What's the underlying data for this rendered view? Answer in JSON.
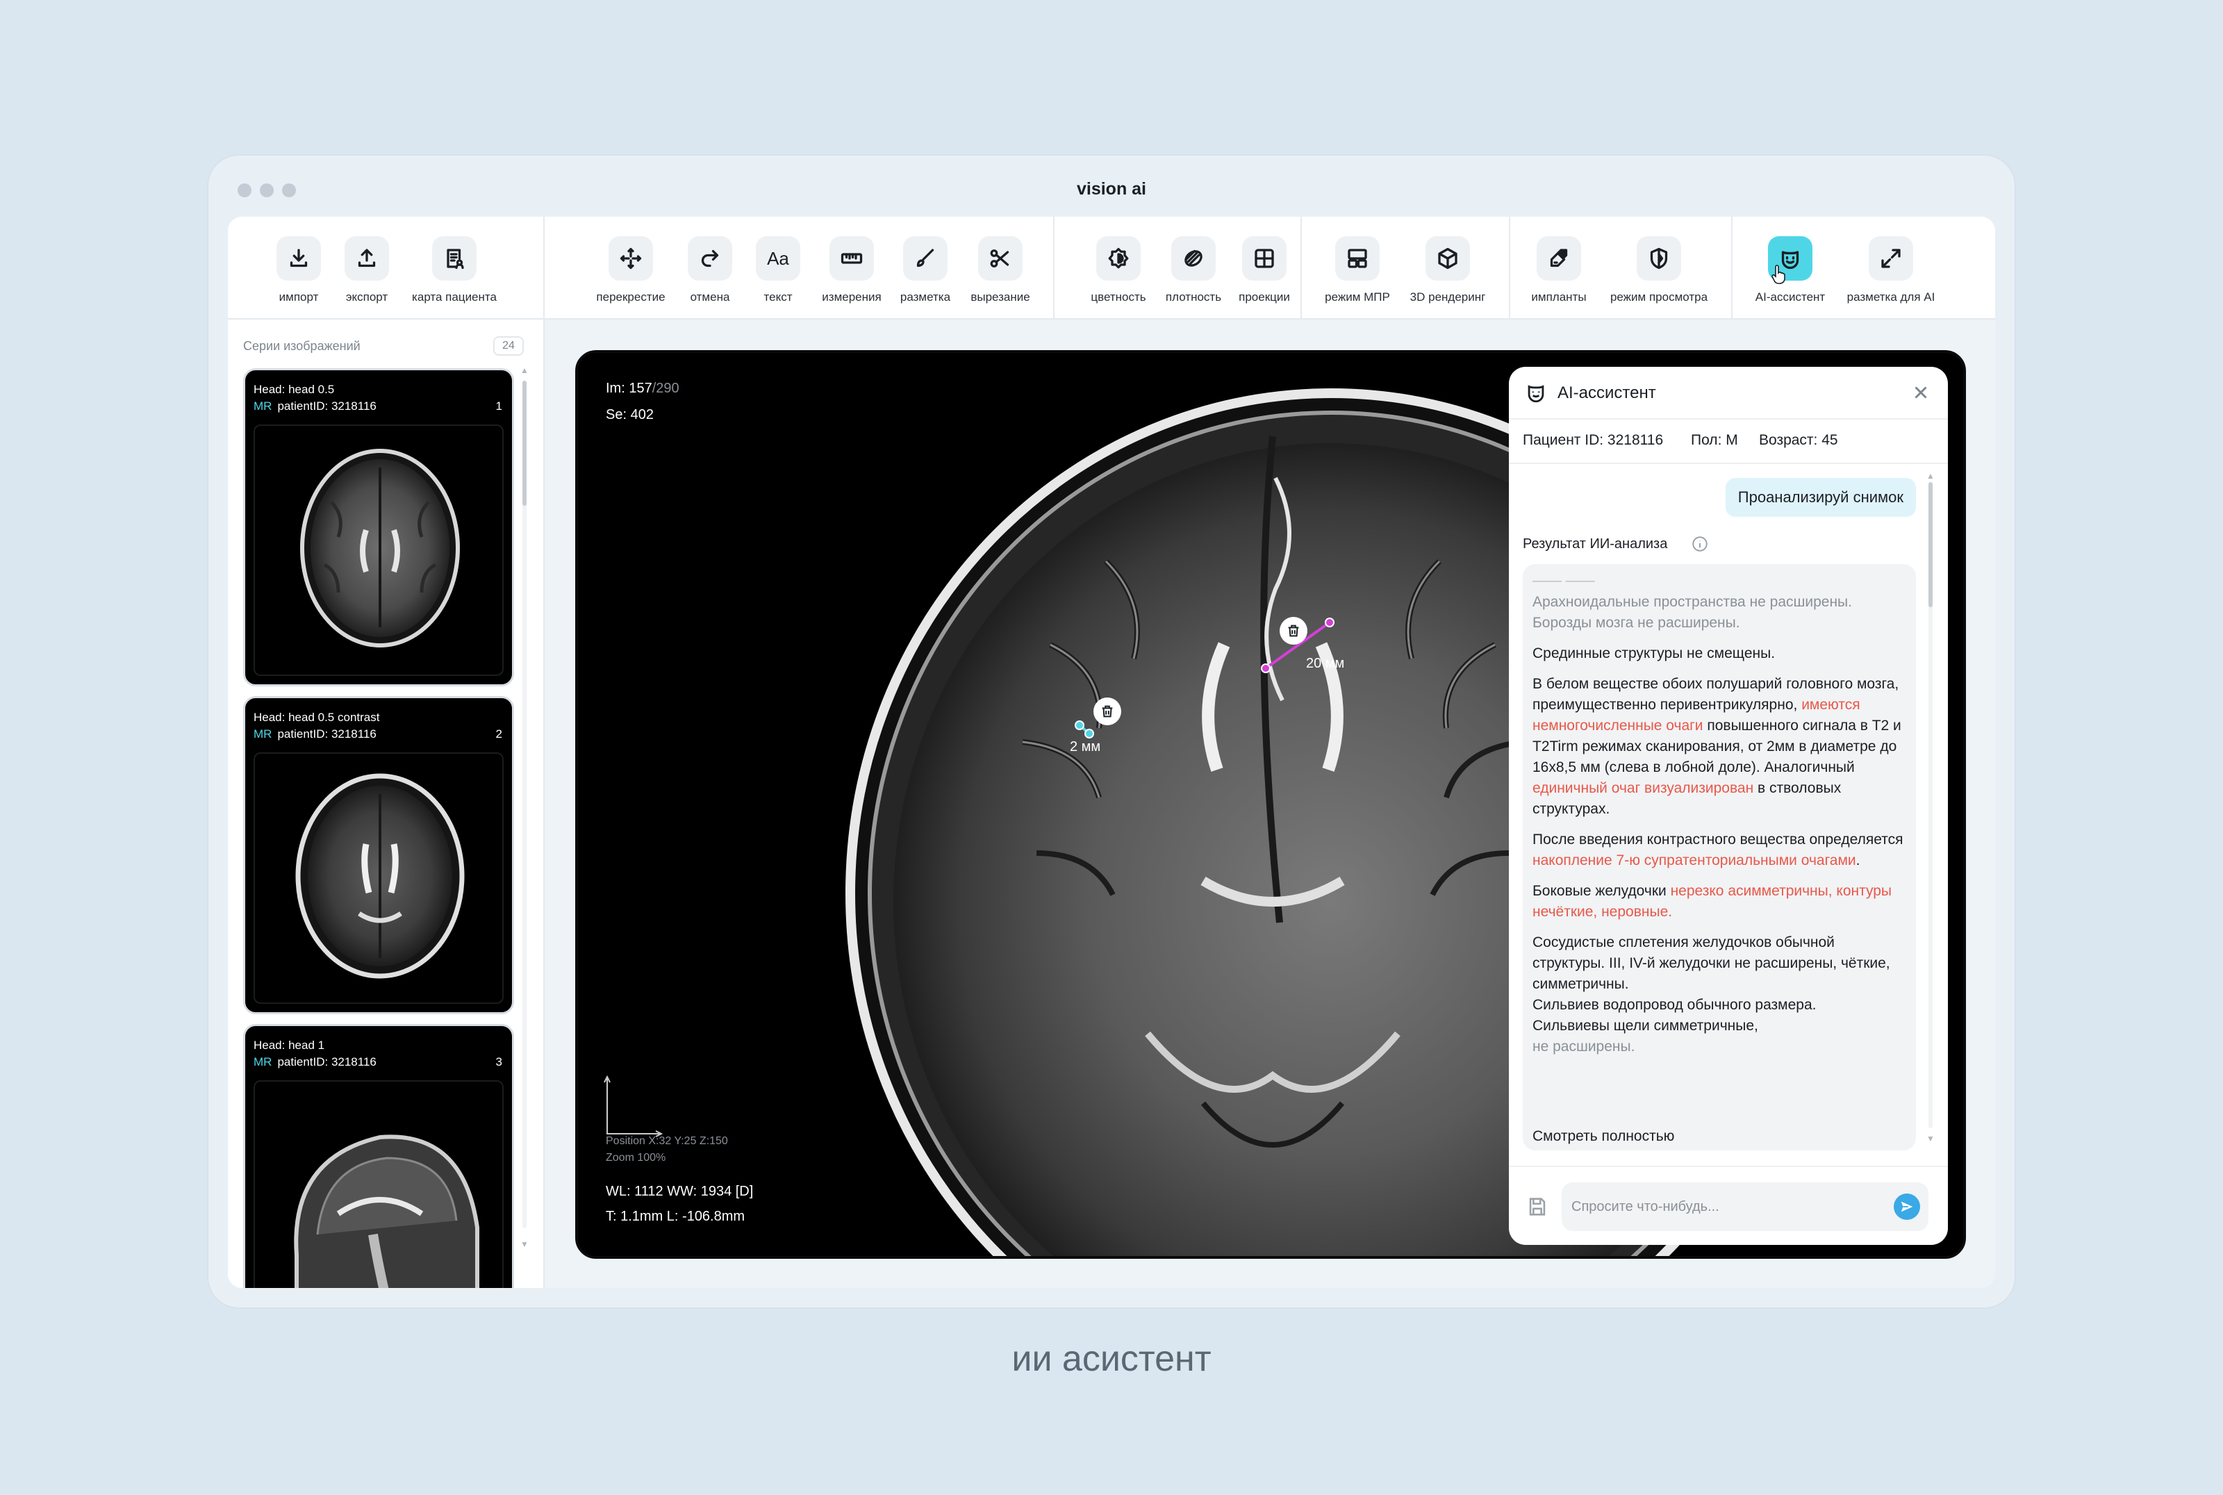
{
  "window": {
    "title": "vision ai"
  },
  "toolbar": {
    "tools": [
      {
        "label": "импорт",
        "icon": "download-icon"
      },
      {
        "label": "экспорт",
        "icon": "upload-icon"
      },
      {
        "label": "карта пациента",
        "icon": "patient-card-icon"
      },
      {
        "label": "перекрестие",
        "icon": "crosshair-icon"
      },
      {
        "label": "отмена",
        "icon": "redo-icon"
      },
      {
        "label": "текст",
        "icon": "text-icon"
      },
      {
        "label": "измерения",
        "icon": "ruler-icon"
      },
      {
        "label": "разметка",
        "icon": "brush-icon"
      },
      {
        "label": "вырезание",
        "icon": "scissors-icon"
      },
      {
        "label": "цветность",
        "icon": "color-icon"
      },
      {
        "label": "плотность",
        "icon": "density-icon"
      },
      {
        "label": "проекции",
        "icon": "grid-icon"
      },
      {
        "label": "режим МПР",
        "icon": "mpr-layout-icon"
      },
      {
        "label": "3D рендеринг",
        "icon": "cube-icon"
      },
      {
        "label": "импланты",
        "icon": "implant-icon"
      },
      {
        "label": "режим просмотра",
        "icon": "shield-view-icon"
      },
      {
        "label": "AI-ассистент",
        "icon": "robot-icon"
      },
      {
        "label": "разметка для AI",
        "icon": "expand-icon"
      }
    ]
  },
  "sidebar": {
    "title": "Серии изображений",
    "count": "24",
    "series": [
      {
        "line1": "Head:  head 0.5",
        "modality": "MR",
        "patient": "patientID: 3218116",
        "number": "1"
      },
      {
        "line1": "Head:  head 0.5 contrast",
        "modality": "MR",
        "patient": "patientID: 3218116",
        "number": "2"
      },
      {
        "line1": "Head:  head 1",
        "modality": "MR",
        "patient": "patientID: 3218116",
        "number": "3"
      }
    ]
  },
  "viewer": {
    "im_label": "Im: 157",
    "im_total": "/290",
    "se": "Se: 402",
    "position": "Position X:32 Y:25 Z:150",
    "zoom": "Zoom 100%",
    "wlww": "WL: 1112  WW: 1934 [D]",
    "tl": "T: 1.1mm  L: -106.8mm",
    "measure1": "20 мм",
    "measure2": "2 мм",
    "measure1_color": "#d43fd8",
    "measure2_color": "#4fd6e6"
  },
  "assistant": {
    "title": "AI-ассистент",
    "patient_id": "Пациент ID: 3218116",
    "sex": "Пол:  М",
    "age": "Возраст: 45",
    "user_message": "Проанализируй снимок",
    "result_title": "Результат ИИ-анализа",
    "p1": "Арахноидальные пространства не расширены. Борозды мозга не расширены.",
    "p2": "Срединные структуры не смещены.",
    "p3a": "В белом веществе обоих полушарий головного мозга, преимущественно перивентрикулярно, ",
    "p3b": "имеются немногочисленные очаги",
    "p3c": " повышенного сигнала в Т2 и T2Tirm режимах сканирования, от 2мм в диаметре до 16x8,5 мм (слева в лобной доле). Аналогичный ",
    "p3d": "единичный очаг визуализирован",
    "p3e": " в стволовых структурах.",
    "p4a": "После введения контрастного вещества определяется ",
    "p4b": "накопление 7-ю супратенториальными очагами",
    "p4c": ".",
    "p5a": "Боковые желудочки ",
    "p5b": "нерезко асимметричны, контуры нечёткие, неровные.",
    "p6": "Сосудистые сплетения желудочков обычной структуры. III, IV-й желудочки не расширены, чёткие, симметричны.",
    "p7": "Сильвиев водопровод обычного размера.",
    "p8": "Сильвиевы щели симметричные,",
    "p9": "не расширены.",
    "see_all": "Смотреть полностью",
    "input_placeholder": "Спросите что-нибудь..."
  },
  "caption": "ии асистент"
}
